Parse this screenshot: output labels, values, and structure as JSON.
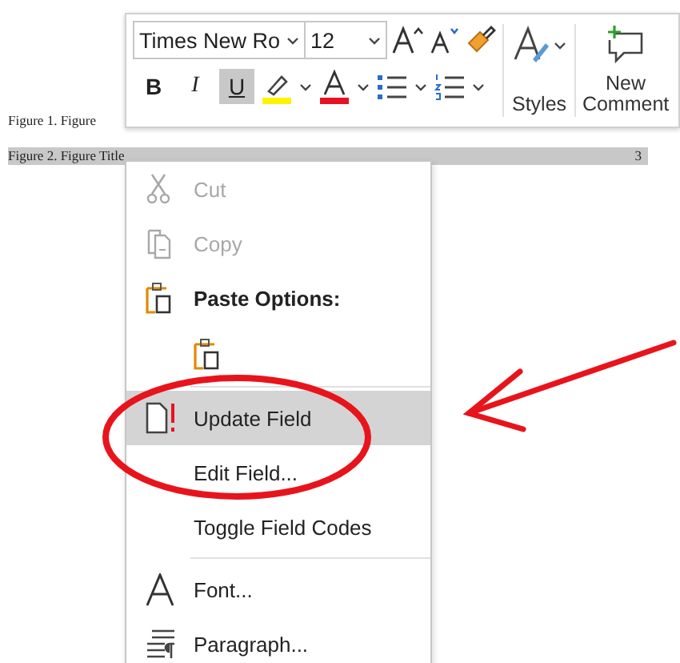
{
  "document": {
    "lines": [
      {
        "text": "Figure 1.  Figure",
        "selected": false
      },
      {
        "text": "Figure 2.  Figure Title",
        "page": "3",
        "selected": true
      }
    ]
  },
  "toolbar": {
    "font_name": "Times New Ro",
    "font_size": "12",
    "format_buttons": [
      {
        "kind": "bold",
        "label": "B",
        "selected": false
      },
      {
        "kind": "italic",
        "label": "I",
        "selected": false
      },
      {
        "kind": "underline",
        "label": "U",
        "selected": true
      }
    ],
    "styles_label": "Styles",
    "comment_label": "New Comment"
  },
  "context_menu": {
    "items": [
      {
        "kind": "cut",
        "label": "Cut",
        "disabled": true,
        "highlighted": false
      },
      {
        "kind": "copy",
        "label": "Copy",
        "disabled": true,
        "highlighted": false
      },
      {
        "kind": "heading",
        "label": "Paste Options:",
        "disabled": false,
        "highlighted": false
      },
      {
        "kind": "paste"
      },
      {
        "kind": "separator"
      },
      {
        "kind": "field",
        "label": "Update Field",
        "disabled": false,
        "highlighted": true
      },
      {
        "kind": "plain",
        "label": "Edit Field...",
        "disabled": false,
        "highlighted": false
      },
      {
        "kind": "plain",
        "label": "Toggle Field Codes",
        "disabled": false,
        "highlighted": false
      },
      {
        "kind": "separator"
      },
      {
        "kind": "font",
        "label": "Font...",
        "disabled": false,
        "highlighted": false
      },
      {
        "kind": "paragraph",
        "label": "Paragraph...",
        "disabled": false,
        "highlighted": false
      }
    ]
  }
}
